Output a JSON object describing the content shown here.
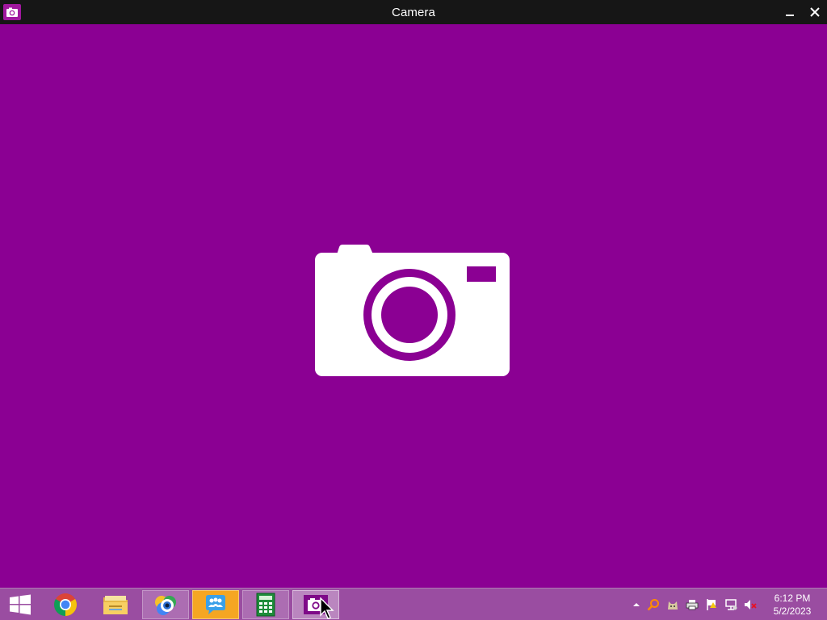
{
  "window": {
    "title": "Camera",
    "icon": "camera-app-icon",
    "controls": [
      "minimize-icon",
      "close-icon"
    ]
  },
  "main": {
    "background_color": "#8b0093",
    "placeholder_icon": "camera-icon"
  },
  "taskbar": {
    "background_color": "#9a4da1",
    "start_icon": "windows-logo-icon",
    "pinned": [
      {
        "name": "chrome",
        "icon": "chrome-icon",
        "state": "pinned"
      },
      {
        "name": "file-explorer",
        "icon": "folder-icon",
        "state": "pinned"
      },
      {
        "name": "vision-app",
        "icon": "eye-icon",
        "state": "running"
      },
      {
        "name": "people-app",
        "icon": "people-chat-icon",
        "state": "running"
      },
      {
        "name": "calculator",
        "icon": "calculator-icon",
        "state": "running"
      },
      {
        "name": "camera",
        "icon": "camera-icon",
        "state": "active"
      }
    ],
    "tray": {
      "icons": [
        "show-hidden-icons-arrow",
        "search-magnifier-icon",
        "cat-app-icon",
        "printer-icon",
        "action-center-flag-icon",
        "network-icon",
        "volume-muted-icon"
      ]
    },
    "clock": {
      "time": "6:12 PM",
      "date": "5/2/2023"
    }
  }
}
